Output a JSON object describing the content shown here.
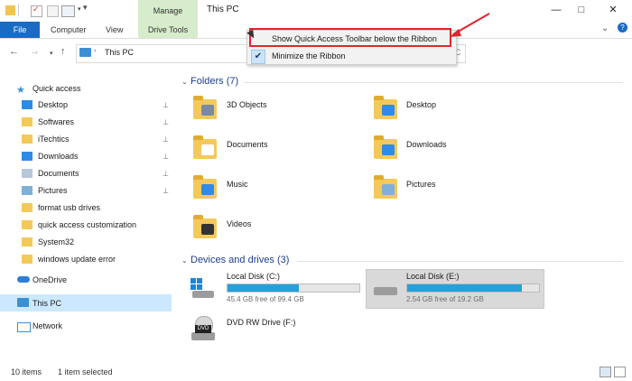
{
  "window": {
    "title": "This PC",
    "manage_tab": "Manage",
    "controls": {
      "minimize": "—",
      "maximize": "□",
      "close": "✕"
    },
    "help": "?"
  },
  "ribbon": {
    "tabs": [
      "File",
      "Computer",
      "View",
      "Drive Tools"
    ],
    "collapse_icon": "chevron-down-icon"
  },
  "address": {
    "path": "This PC",
    "search_fragment": "C"
  },
  "context_menu": {
    "items": [
      {
        "label": "Show Quick Access Toolbar below the Ribbon",
        "checked": false
      },
      {
        "label": "Minimize the Ribbon",
        "checked": true
      }
    ]
  },
  "sidebar": {
    "quick_access_label": "Quick access",
    "items": [
      {
        "label": "Desktop",
        "pinned": true,
        "icon": "desktop-icon"
      },
      {
        "label": "Softwares",
        "pinned": true,
        "icon": "folder-icon"
      },
      {
        "label": "iTechtics",
        "pinned": true,
        "icon": "folder-icon"
      },
      {
        "label": "Downloads",
        "pinned": true,
        "icon": "download-icon"
      },
      {
        "label": "Documents",
        "pinned": true,
        "icon": "documents-icon"
      },
      {
        "label": "Pictures",
        "pinned": true,
        "icon": "pictures-icon"
      },
      {
        "label": "format usb drives",
        "pinned": false,
        "icon": "folder-icon"
      },
      {
        "label": "quick access customization",
        "pinned": false,
        "icon": "folder-icon"
      },
      {
        "label": "System32",
        "pinned": false,
        "icon": "folder-icon"
      },
      {
        "label": "windows update error",
        "pinned": false,
        "icon": "folder-icon"
      }
    ],
    "onedrive_label": "OneDrive",
    "thispc_label": "This PC",
    "network_label": "Network",
    "pin_glyph": "📌"
  },
  "content": {
    "folders_header": "Folders (7)",
    "folders": [
      {
        "label": "3D Objects"
      },
      {
        "label": "Desktop"
      },
      {
        "label": "Documents"
      },
      {
        "label": "Downloads"
      },
      {
        "label": "Music"
      },
      {
        "label": "Pictures"
      },
      {
        "label": "Videos"
      }
    ],
    "drives_header": "Devices and drives (3)",
    "drives": [
      {
        "label": "Local Disk (C:)",
        "free": "45.4 GB free of 99.4 GB",
        "used_fraction": 0.54
      },
      {
        "label": "Local Disk (E:)",
        "free": "2.54 GB free of 19.2 GB",
        "used_fraction": 0.87
      },
      {
        "label": "DVD RW Drive (F:)",
        "free": "",
        "used_fraction": null
      }
    ],
    "dvd_badge": "DVD"
  },
  "status": {
    "items_count": "10 items",
    "selected": "1 item selected"
  },
  "colors": {
    "file_tab": "#1a6bc4",
    "manage_tab": "#d7eccb",
    "section_title": "#1e3f8a",
    "drive_fill": "#26a0da",
    "highlight": "#e1252f"
  }
}
